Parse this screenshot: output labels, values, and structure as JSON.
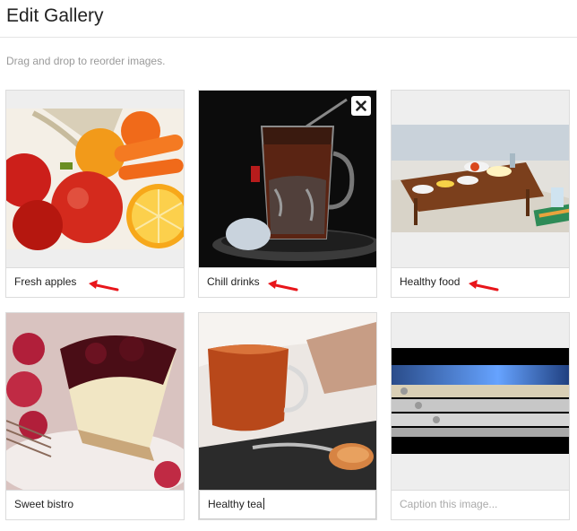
{
  "header": {
    "title": "Edit Gallery"
  },
  "instructions": "Drag and drop to reorder images.",
  "gallery": {
    "items": [
      {
        "caption": "Fresh apples",
        "image": "fruit-bowl-photo",
        "annotated": true
      },
      {
        "caption": "Chill drinks",
        "image": "tea-glass-photo",
        "annotated": true,
        "hovered": true
      },
      {
        "caption": "Healthy food",
        "image": "beach-picnic-photo",
        "annotated": true
      },
      {
        "caption": "Sweet bistro",
        "image": "cheesecake-photo"
      },
      {
        "caption": "Healthy tea",
        "image": "tea-cup-photo",
        "editing": true
      },
      {
        "caption": "",
        "placeholder": "Caption this image...",
        "image": "phone-stack-photo"
      }
    ]
  },
  "colors": {
    "annotation_arrow": "#e8161b",
    "tile_border": "#dcdcdc"
  },
  "icons": {
    "delete": "close-icon",
    "annotation": "arrow-icon"
  }
}
